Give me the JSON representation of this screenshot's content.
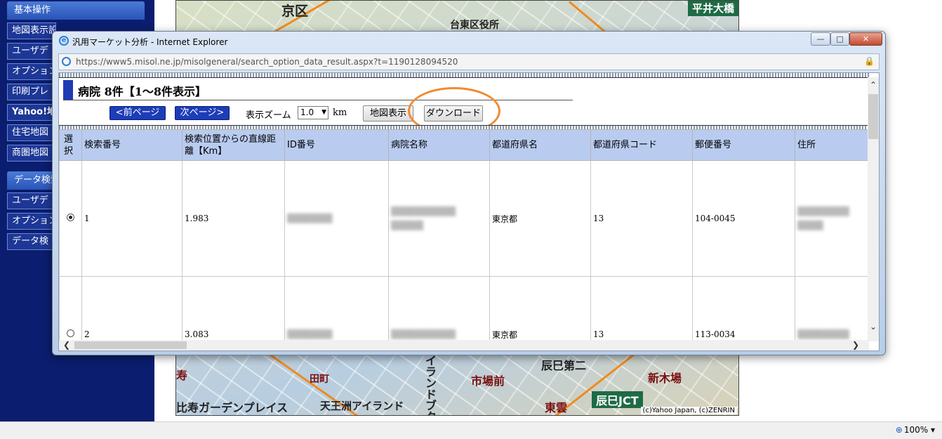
{
  "sidebar": {
    "section1": "基本操作",
    "items1": [
      "地図表示設定",
      "ユーザデ",
      "オプション",
      "印刷プレ",
      "Yahoo!地",
      "住宅地図",
      "商圏地図"
    ],
    "section2": "データ検索",
    "items2": [
      "ユーザデ",
      "オプション",
      "データ検"
    ]
  },
  "map": {
    "labels": [
      "京区",
      "台東区役所",
      "平井大橋",
      "寿",
      "田町",
      "イランドブクエア",
      "市場前",
      "辰巳第二",
      "新木場",
      "比寿ガーデンプレイス",
      "天王洲アイランド",
      "東雲",
      "辰巳JCT"
    ],
    "copyright": "(c)Yahoo Japan, (c)ZENRIN"
  },
  "browser": {
    "title": "汎用マーケット分析 - Internet Explorer",
    "url": "https://www5.misol.ne.jp/misolgeneral/search_option_data_result.aspx?t=1190128094520",
    "minimize": "—",
    "maximize": "□",
    "close": "✕"
  },
  "page": {
    "result_title": "病院 8件【1〜8件表示】",
    "prev_page": "<前ページ",
    "next_page": "次ページ>",
    "zoom_label": "表示ズーム",
    "zoom_value": "1.0",
    "zoom_unit": "km",
    "map_display_button": "地図表示",
    "download_button": "ダウンロード"
  },
  "table": {
    "headers": [
      "選択",
      "検索番号",
      "検索位置からの直線距離【Km】",
      "ID番号",
      "病院名称",
      "都道府県名",
      "都道府県コード",
      "郵便番号",
      "住所"
    ],
    "rows": [
      {
        "selected": true,
        "no": "1",
        "distance": "1.983",
        "id": "",
        "name": "",
        "pref": "東京都",
        "pref_code": "13",
        "zip": "104-0045",
        "address": ""
      },
      {
        "selected": false,
        "no": "2",
        "distance": "3.083",
        "id": "",
        "name": "",
        "pref": "東京都",
        "pref_code": "13",
        "zip": "113-0034",
        "address": ""
      }
    ]
  },
  "statusbar": {
    "zoom": "100%"
  }
}
